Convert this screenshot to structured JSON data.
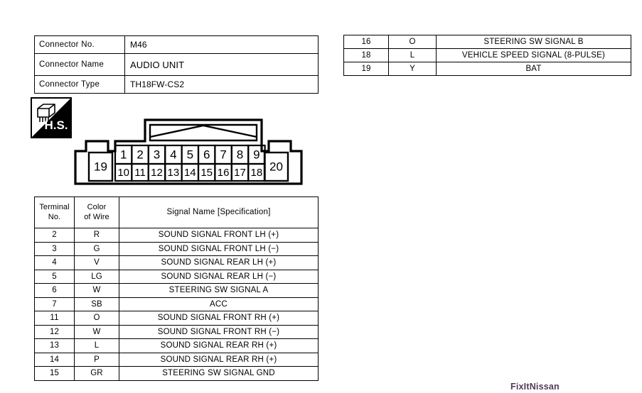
{
  "connector_info": {
    "rows": [
      {
        "label": "Connector No.",
        "value": "M46"
      },
      {
        "label": "Connector Name",
        "value": "AUDIO UNIT"
      },
      {
        "label": "Connector Type",
        "value": "TH18FW-CS2"
      }
    ]
  },
  "terminal_extra": {
    "rows": [
      {
        "no": "16",
        "color": "O",
        "signal": "STEERING SW SIGNAL B"
      },
      {
        "no": "18",
        "color": "L",
        "signal": "VEHICLE SPEED SIGNAL (8-PULSE)"
      },
      {
        "no": "19",
        "color": "Y",
        "signal": "BAT"
      }
    ]
  },
  "terminal_main": {
    "headers": {
      "no": "Terminal\nNo.",
      "no_line1": "Terminal",
      "no_line2": "No.",
      "color_line1": "Color",
      "color_line2": "of Wire",
      "signal": "Signal Name [Specification]"
    },
    "rows": [
      {
        "no": "2",
        "color": "R",
        "signal": "SOUND SIGNAL FRONT LH (+)"
      },
      {
        "no": "3",
        "color": "G",
        "signal": "SOUND SIGNAL FRONT LH (−)"
      },
      {
        "no": "4",
        "color": "V",
        "signal": "SOUND SIGNAL REAR LH (+)"
      },
      {
        "no": "5",
        "color": "LG",
        "signal": "SOUND SIGNAL REAR LH (−)"
      },
      {
        "no": "6",
        "color": "W",
        "signal": "STEERING SW SIGNAL A"
      },
      {
        "no": "7",
        "color": "SB",
        "signal": "ACC"
      },
      {
        "no": "11",
        "color": "O",
        "signal": "SOUND SIGNAL FRONT RH (+)"
      },
      {
        "no": "12",
        "color": "W",
        "signal": "SOUND SIGNAL FRONT RH (−)"
      },
      {
        "no": "13",
        "color": "L",
        "signal": "SOUND SIGNAL REAR RH (+)"
      },
      {
        "no": "14",
        "color": "P",
        "signal": "SOUND SIGNAL REAR RH (+)"
      },
      {
        "no": "15",
        "color": "GR",
        "signal": "STEERING SW SIGNAL GND"
      }
    ]
  },
  "hs_badge": {
    "label": "H.S."
  },
  "pin_diagram": {
    "top_row": [
      "1",
      "2",
      "3",
      "4",
      "5",
      "6",
      "7",
      "8",
      "9"
    ],
    "bottom_row": [
      "10",
      "11",
      "12",
      "13",
      "14",
      "15",
      "16",
      "17",
      "18"
    ],
    "left_pin": "19",
    "right_pin": "20"
  },
  "watermark": {
    "text": "FixItNissan"
  },
  "colors": {
    "ink": "#000000",
    "paper": "#ffffff",
    "watermark": "#3a1f3d"
  }
}
